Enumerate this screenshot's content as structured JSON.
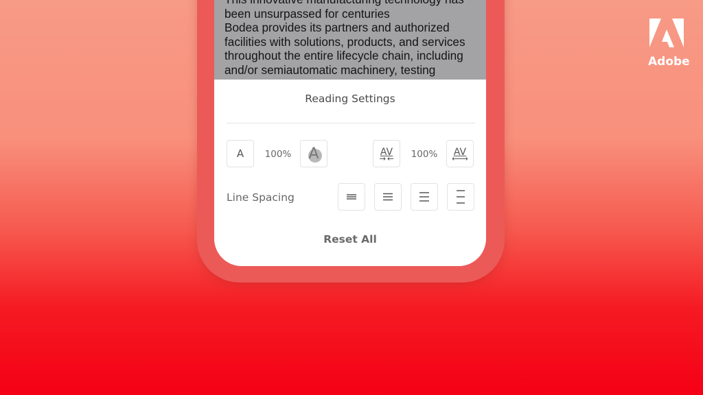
{
  "passage": {
    "lines": [
      "This innovative manufacturing technology has",
      "been unsurpassed for centuries",
      "Bodea provides its partners and authorized",
      "facilities with solutions, products, and services",
      "throughout the entire lifecycle chain, including",
      "and/or semiautomatic machinery, testing"
    ]
  },
  "panel": {
    "title": "Reading Settings",
    "font_size": {
      "decrease_glyph": "A",
      "value": "100%",
      "increase_glyph": "A"
    },
    "char_spacing": {
      "decrease_glyph": "AV",
      "value": "100%",
      "increase_glyph": "AV"
    },
    "line_spacing": {
      "label": "Line Spacing",
      "options": [
        "tight",
        "normal",
        "relaxed",
        "loose"
      ]
    },
    "reset_label": "Reset All"
  },
  "brand": {
    "name": "Adobe",
    "color": "#ffffff"
  },
  "colors": {
    "background_top": "#f79a86",
    "background_bottom": "#f50015",
    "phone_frame": "#ec5a58"
  }
}
